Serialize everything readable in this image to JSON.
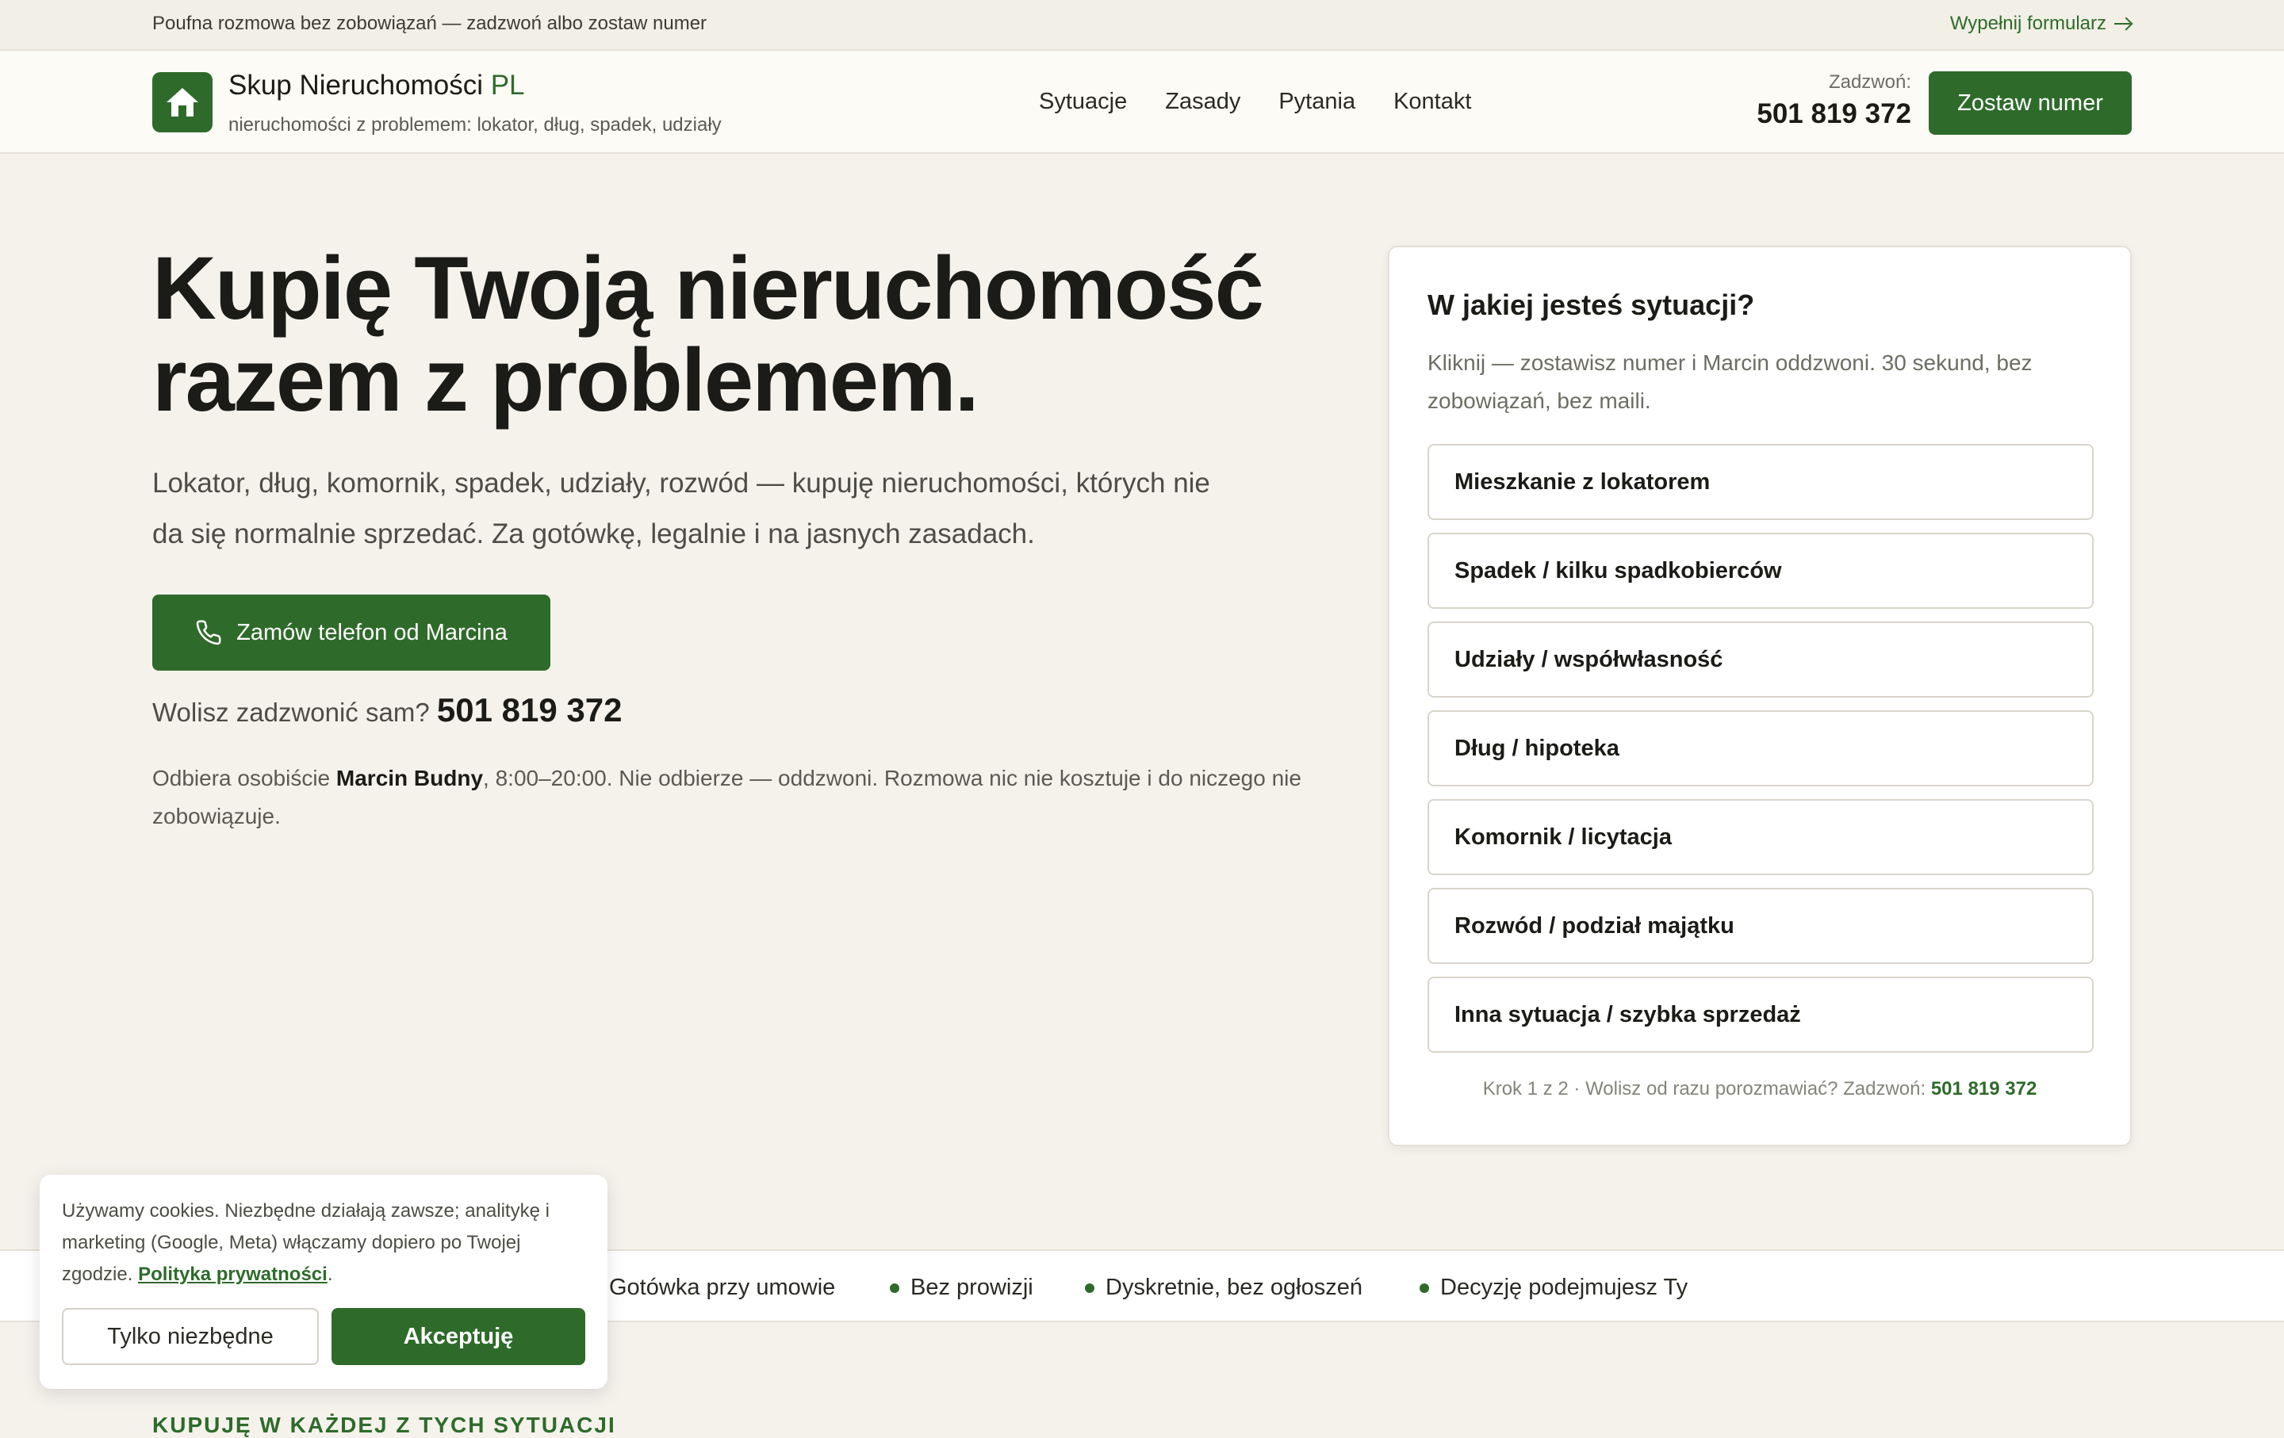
{
  "topbar": {
    "note": "Poufna rozmowa bez zobowiązań — zadzwoń albo zostaw numer",
    "form_link": "Wypełnij formularz"
  },
  "header": {
    "brand_main": "Skup Nieruchomości",
    "brand_accent": "PL",
    "tagline": "nieruchomości z problemem: lokator, dług, spadek, udziały",
    "nav": [
      "Sytuacje",
      "Zasady",
      "Pytania",
      "Kontakt"
    ],
    "call_label": "Zadzwoń:",
    "phone": "501 819 372",
    "cta": "Zostaw numer"
  },
  "hero": {
    "title_line1": "Kupię Twoją nieruchomość",
    "title_line2": "razem z problemem.",
    "subtitle": "Lokator, dług, komornik, spadek, udziały, rozwód — kupuję nieruchomości, których nie da się normalnie sprzedać. Za gotówkę, legalnie i na jasnych zasadach.",
    "cta": "Zamów telefon od Marcina",
    "prefer_text": "Wolisz zadzwonić sam?",
    "phone": "501 819 372",
    "answer_pre": "Odbiera osobiście",
    "answer_name": "Marcin Budny",
    "answer_post": ", 8:00–20:00. Nie odbierze — oddzwoni. Rozmowa nic nie kosztuje i do niczego nie zobowiązuje."
  },
  "panel": {
    "title": "W jakiej jesteś sytuacji?",
    "description": "Kliknij — zostawisz numer i Marcin oddzwoni. 30 sekund, bez zobowiązań, bez maili.",
    "options": [
      "Mieszkanie z lokatorem",
      "Spadek / kilku spadkobierców",
      "Udziały / współwłasność",
      "Dług / hipoteka",
      "Komornik / licytacja",
      "Rozwód / podział majątku",
      "Inna sytuacja / szybka sprzedaż"
    ],
    "step_text": "Krok 1 z 2 · Wolisz od razu porozmawiać? Zadzwoń:",
    "step_phone": "501 819 372"
  },
  "strip": [
    "Gotówka przy umowie",
    "Bez prowizji",
    "Dyskretnie, bez ogłoszeń",
    "Decyzję podejmujesz Ty"
  ],
  "lower": {
    "heading": "KUPUJĘ W KAŻDEJ Z TYCH SYTUACJI"
  },
  "cookie": {
    "text": "Używamy cookies. Niezbędne działają zawsze; analitykę i marketing (Google, Meta) włączamy dopiero po Twojej zgodzie.",
    "link": "Polityka prywatności",
    "necessary": "Tylko niezbędne",
    "accept": "Akceptuję"
  },
  "colors": {
    "accent": "#2e6b2a",
    "background": "#f5f2ec",
    "header_bg": "#fdfbf6"
  },
  "icons": [
    "home-icon",
    "arrow-right-icon",
    "phone-icon",
    "bullet-dot-icon"
  ]
}
